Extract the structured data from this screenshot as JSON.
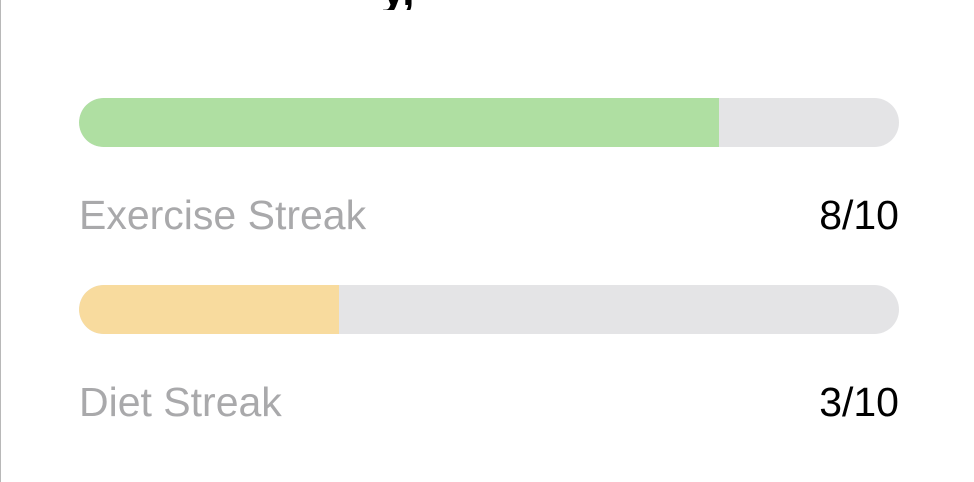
{
  "header": {
    "title_fragment": "y,"
  },
  "streaks": [
    {
      "label": "Exercise Streak",
      "value_text": "8/10",
      "progress": 0.78,
      "fill_color": "#afdfa2"
    },
    {
      "label": "Diet Streak",
      "value_text": "3/10",
      "progress": 0.317,
      "fill_color": "#f8db9e"
    }
  ],
  "colors": {
    "track": "#e4e4e6",
    "label": "#a9a9ab",
    "value": "#000000"
  }
}
